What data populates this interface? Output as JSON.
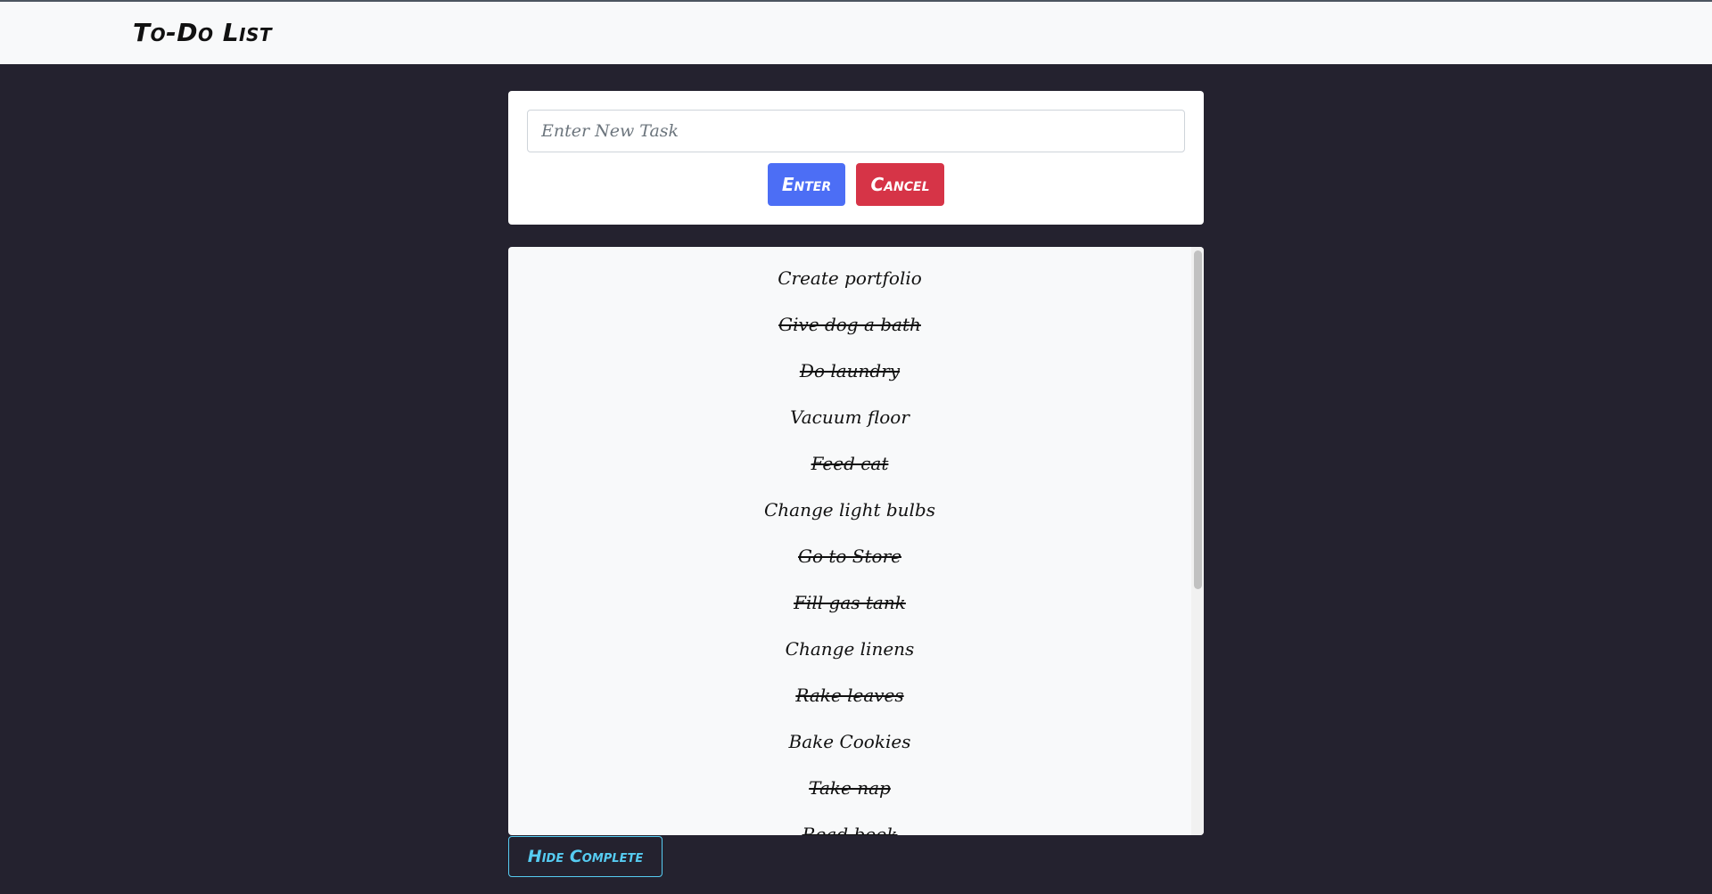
{
  "navbar": {
    "brand": "To-Do List"
  },
  "new_task": {
    "placeholder": "Enter New Task",
    "value": "",
    "enter_label": "Enter",
    "cancel_label": "Cancel"
  },
  "tasks": [
    {
      "label": "Create portfolio",
      "completed": false
    },
    {
      "label": "Give dog a bath",
      "completed": true
    },
    {
      "label": "Do laundry",
      "completed": true
    },
    {
      "label": "Vacuum floor",
      "completed": false
    },
    {
      "label": "Feed cat",
      "completed": true
    },
    {
      "label": "Change light bulbs",
      "completed": false
    },
    {
      "label": "Go to Store",
      "completed": true
    },
    {
      "label": "Fill gas tank",
      "completed": true
    },
    {
      "label": "Change linens",
      "completed": false
    },
    {
      "label": "Rake leaves",
      "completed": true
    },
    {
      "label": "Bake Cookies",
      "completed": false
    },
    {
      "label": "Take nap",
      "completed": true
    },
    {
      "label": "Read book",
      "completed": true
    }
  ],
  "footer": {
    "hide_complete_label": "Hide Complete"
  },
  "colors": {
    "background": "#24222f",
    "navbar": "#f8f9fa",
    "enter_button": "#4c6ef5",
    "cancel_button": "#d63447",
    "hide_complete_outline": "#56ccf2"
  }
}
